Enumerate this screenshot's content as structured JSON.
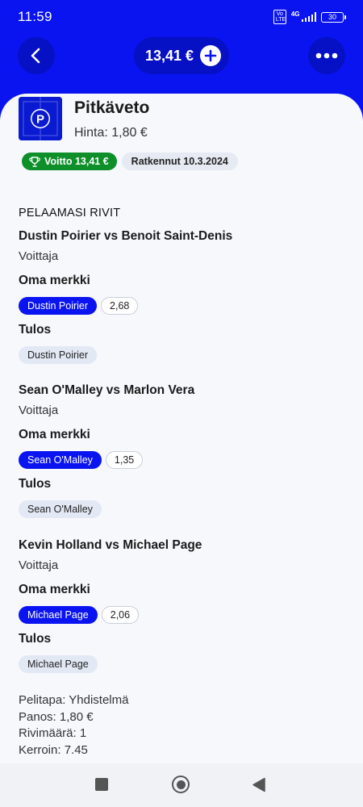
{
  "status": {
    "time": "11:59",
    "volte": "Vo LTE",
    "network": "4G",
    "battery": "30"
  },
  "header": {
    "balance": "13,41 €",
    "back_icon": "chevron-left-icon",
    "plus_icon": "plus-circle-icon",
    "more_icon": "more-dots-icon"
  },
  "product": {
    "icon_letter": "P",
    "title": "Pitkäveto",
    "price": "Hinta: 1,80 €",
    "win_badge": "Voitto 13,41 €",
    "settled_badge": "Ratkennut 10.3.2024"
  },
  "rows_title": "PELAAMASI RIVIT",
  "matches": [
    {
      "name": "Dustin Poirier vs Benoit Saint-Denis",
      "market": "Voittaja",
      "selection_label": "Oma merkki",
      "selection": "Dustin Poirier",
      "odds": "2,68",
      "result_label": "Tulos",
      "result": "Dustin Poirier"
    },
    {
      "name": "Sean O'Malley vs Marlon Vera",
      "market": "Voittaja",
      "selection_label": "Oma merkki",
      "selection": "Sean O'Malley",
      "odds": "1,35",
      "result_label": "Tulos",
      "result": "Sean O'Malley"
    },
    {
      "name": "Kevin Holland vs Michael Page",
      "market": "Voittaja",
      "selection_label": "Oma merkki",
      "selection": "Michael Page",
      "odds": "2,06",
      "result_label": "Tulos",
      "result": "Michael Page"
    }
  ],
  "summary": {
    "game_type": "Pelitapa: Yhdistelmä",
    "stake": "Panos: 1,80 €",
    "row_count": "Rivimäärä: 1",
    "odds": "Kerroin: 7.45"
  },
  "colors": {
    "brand_blue": "#0a14f0",
    "win_green": "#0e8f2a"
  }
}
